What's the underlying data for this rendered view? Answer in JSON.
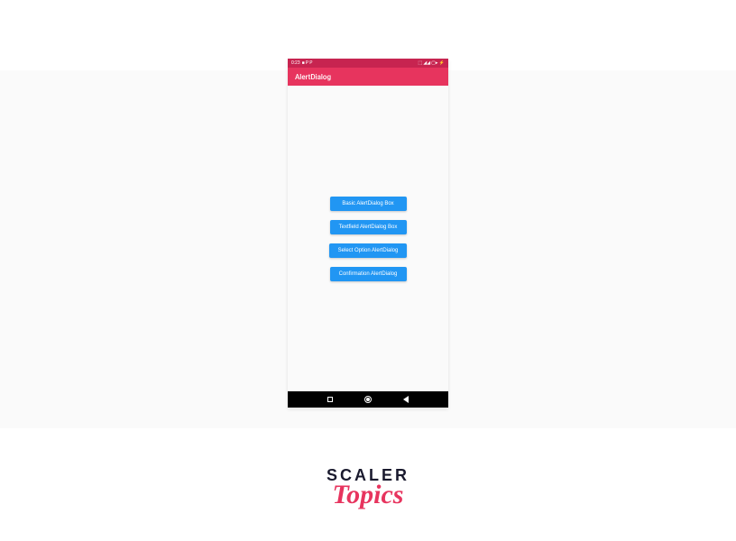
{
  "statusBar": {
    "time": "0:23",
    "leftIcons": "■ P P",
    "rightIcons": "⬚ ◢◢ ▢▸ ⚡"
  },
  "appBar": {
    "title": "AlertDialog"
  },
  "buttons": {
    "basic": "Basic AlertDialog Box",
    "textfield": "Textfield AlertDialog Box",
    "selectOption": "Select Option AlertDialog",
    "confirmation": "Confirmation AlertDialog"
  },
  "logo": {
    "line1": "SCALER",
    "line2": "Topics"
  }
}
